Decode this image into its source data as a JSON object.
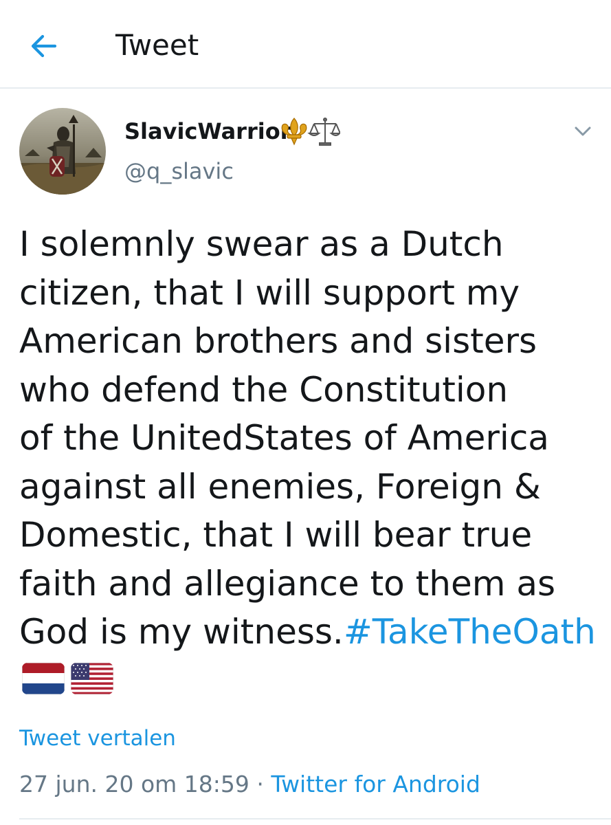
{
  "header": {
    "title": "Tweet",
    "back_icon": "arrow-left-icon",
    "accent_color": "#1b95e0"
  },
  "author": {
    "display_name": "SlavicWarrior",
    "badges": [
      "fleur-de-lis-emoji",
      "balance-scale-emoji"
    ],
    "handle": "@q_slavic"
  },
  "tweet": {
    "lines": [
      "I solemnly swear as a Dutch",
      "citizen, that I will support my",
      "American brothers and sisters",
      "who defend the Constitution",
      "of the UnitedStates of America",
      "against all enemies, Foreign &",
      "Domestic, that I will bear true",
      "faith and allegiance to them as",
      "God is my witness."
    ],
    "hashtag": "#TakeTheOath",
    "flags": [
      "netherlands-flag",
      "usa-flag"
    ]
  },
  "translate_label": "Tweet vertalen",
  "meta": {
    "date": "27 jun. 20 om 18:59",
    "separator": "·",
    "source": "Twitter for Android"
  }
}
